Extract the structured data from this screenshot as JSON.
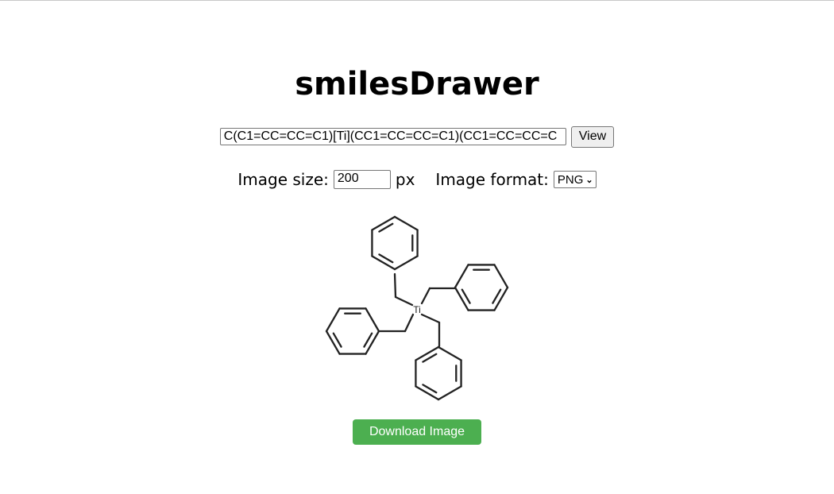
{
  "header": {
    "title": "smilesDrawer"
  },
  "smiles": {
    "value": "C(C1=CC=CC=C1)[Ti](CC1=CC=CC=C1)(CC1=CC=CC=C",
    "view_label": "View"
  },
  "options": {
    "size_label": "Image size:",
    "size_value": "200",
    "size_unit": "px",
    "format_label": "Image format:",
    "format_value": "PNG"
  },
  "molecule": {
    "atom_label": "Ti"
  },
  "download": {
    "label": "Download Image"
  },
  "colors": {
    "download_bg": "#4caf50",
    "bond": "#222222"
  }
}
